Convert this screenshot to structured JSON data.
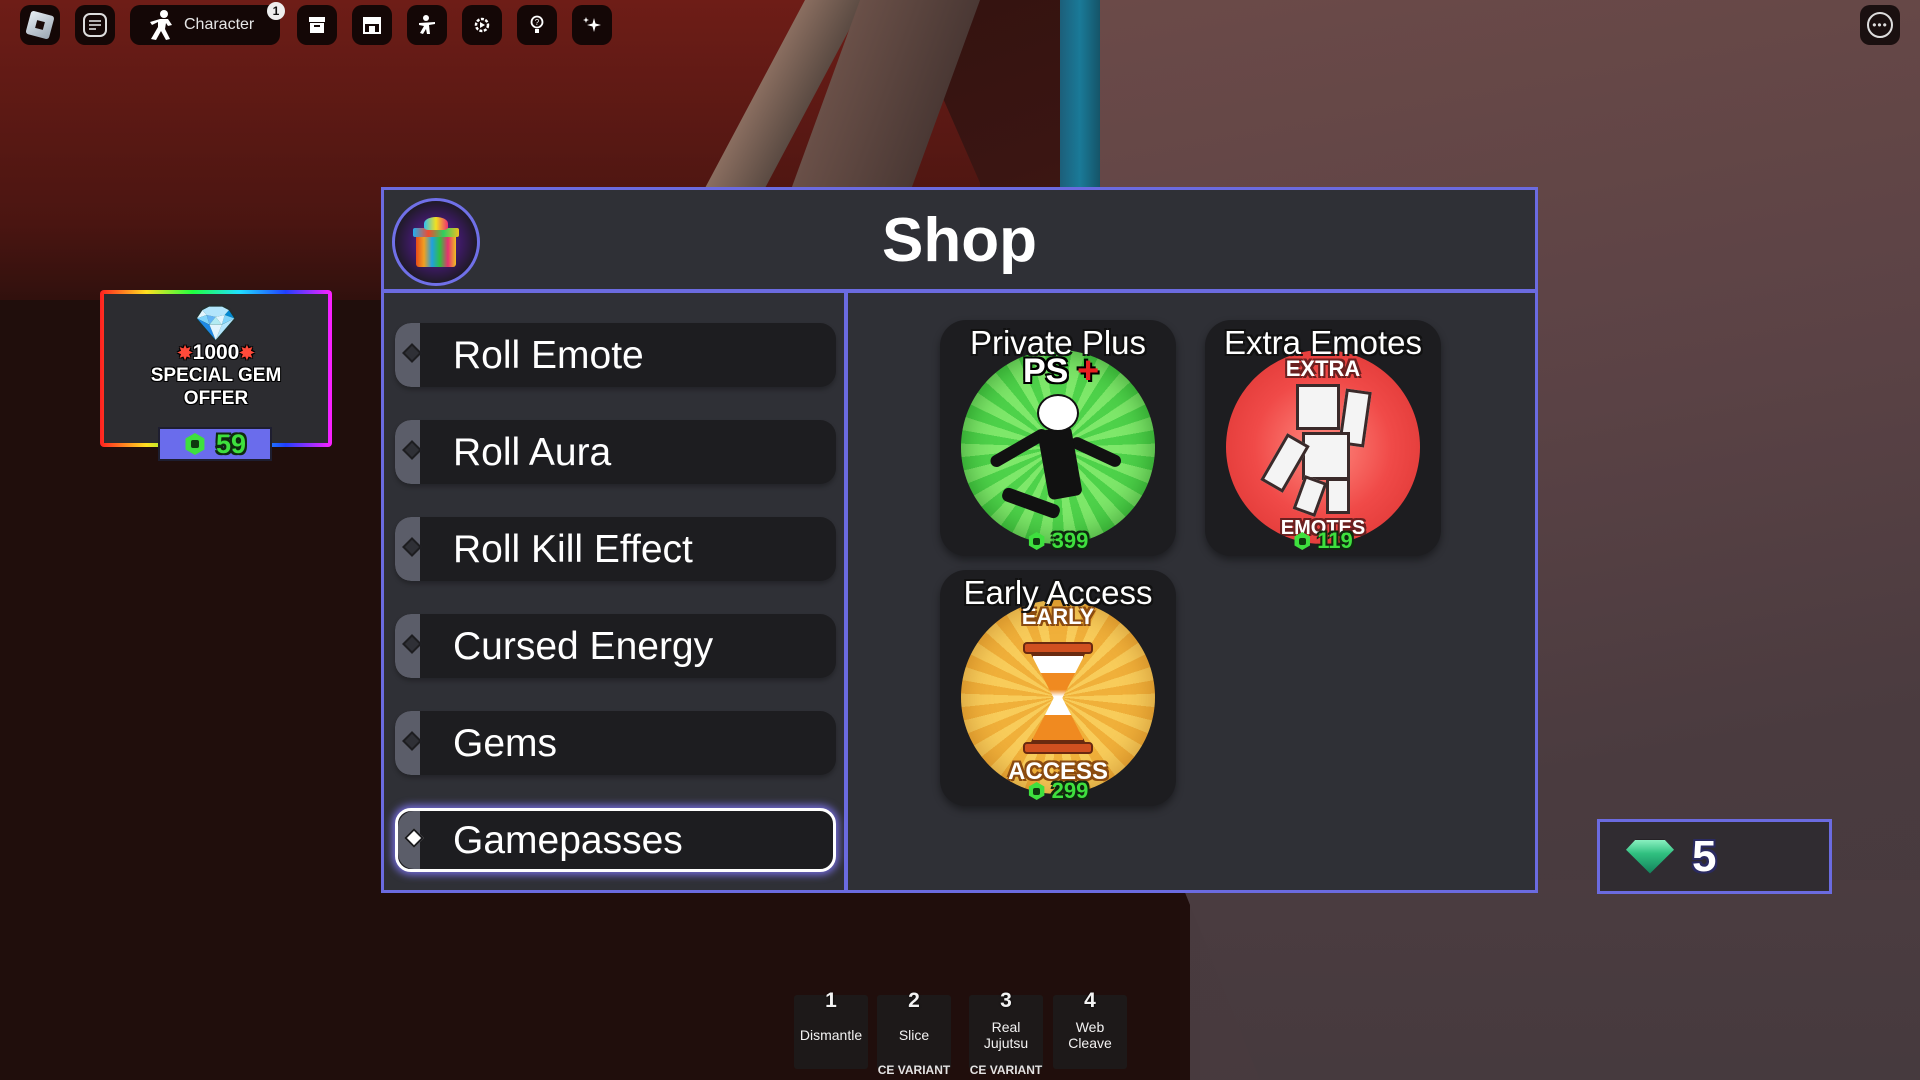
{
  "topbar": {
    "character_label": "Character",
    "notification_count": "1",
    "icons": [
      "roblox-menu-icon",
      "chat-icon",
      "inventory-icon",
      "shop-icon",
      "emotes-icon",
      "settings-icon",
      "help-icon",
      "sparkle-icon"
    ],
    "more_label": "•••"
  },
  "offer": {
    "amount": "1000",
    "line1": "SPECIAL GEM",
    "line2": "OFFER",
    "price": "59",
    "burst_glyph": "✸",
    "gem_glyph": "💎"
  },
  "shop": {
    "title": "Shop",
    "menu": [
      {
        "label": "Roll Emote",
        "active": false
      },
      {
        "label": "Roll Aura",
        "active": false
      },
      {
        "label": "Roll Kill Effect",
        "active": false
      },
      {
        "label": "Cursed Energy",
        "active": false
      },
      {
        "label": "Gems",
        "active": false
      },
      {
        "label": "Gamepasses",
        "active": true
      }
    ],
    "cards": [
      {
        "title": "Private Plus",
        "price": "399",
        "art_text": "PS",
        "art_plus": "+"
      },
      {
        "title": "Extra Emotes",
        "price": "119",
        "art_top": "EXTRA",
        "art_bottom": "EMOTES"
      },
      {
        "title": "Early Access",
        "price": "299",
        "art_top": "EARLY",
        "art_bottom": "ACCESS"
      }
    ]
  },
  "gems": {
    "count": "5"
  },
  "hotbar": [
    {
      "key": "1",
      "label": "Dismantle",
      "sub": ""
    },
    {
      "key": "2",
      "label": "Slice",
      "sub": "CE VARIANT"
    },
    {
      "key": "3",
      "label": "Real Jujutsu",
      "sub": "CE VARIANT"
    },
    {
      "key": "4",
      "label": "Web Cleave",
      "sub": ""
    }
  ],
  "colors": {
    "accent_border": "#6b6be0",
    "panel_bg": "#2f3036",
    "price_green": "#3ee03e"
  }
}
